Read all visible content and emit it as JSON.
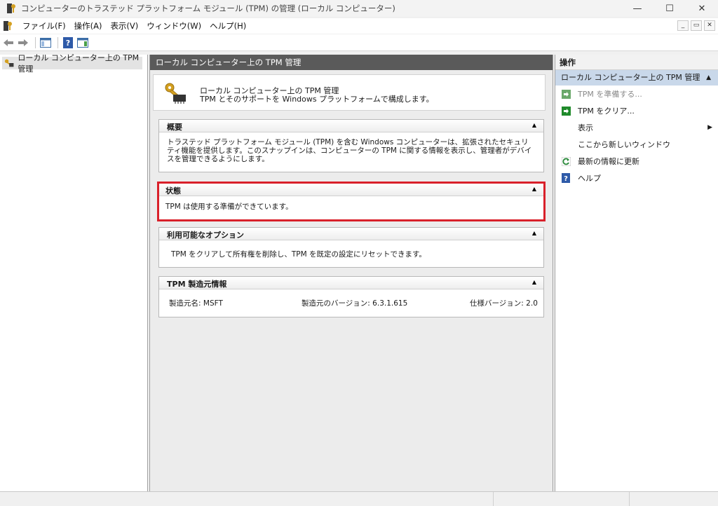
{
  "window": {
    "title": "コンピューターのトラステッド プラットフォーム モジュール (TPM) の管理 (ローカル コンピューター)",
    "minimize": "—",
    "maximize": "☐",
    "close": "✕"
  },
  "menu": {
    "items": [
      "ファイル(F)",
      "操作(A)",
      "表示(V)",
      "ウィンドウ(W)",
      "ヘルプ(H)"
    ],
    "mdi_min": "_",
    "mdi_restore": "▭",
    "mdi_close": "✕"
  },
  "tree": {
    "root_label": "ローカル コンピューター上の TPM 管理"
  },
  "center": {
    "header": "ローカル コンピューター上の TPM 管理",
    "intro_title": "ローカル コンピューター上の TPM 管理",
    "intro_subtitle": "TPM とそのサポートを Windows プラットフォームで構成します。",
    "overview": {
      "title": "概要",
      "text": "トラステッド プラットフォーム モジュール (TPM) を含む Windows コンピューターは、拡張されたセキュリティ機能を提供します。このスナップインは、コンピューターの TPM に関する情報を表示し、管理者がデバイスを管理できるようにします。"
    },
    "status": {
      "title": "状態",
      "text": "TPM は使用する準備ができています。"
    },
    "options": {
      "title": "利用可能なオプション",
      "text": "TPM をクリアして所有権を削除し、TPM を既定の設定にリセットできます。"
    },
    "manufacturer": {
      "title": "TPM 製造元情報",
      "name_label": "製造元名:",
      "name_value": "MSFT",
      "version_label": "製造元のバージョン:",
      "version_value": "6.3.1.615",
      "spec_label": "仕様バージョン:",
      "spec_value": "2.0"
    },
    "collapse_glyph": "▲"
  },
  "actions": {
    "header": "操作",
    "group_title": "ローカル コンピューター上の TPM 管理",
    "items": [
      {
        "label": "TPM を準備する...",
        "icon": "green-arrow-icon",
        "enabled": false
      },
      {
        "label": "TPM をクリア...",
        "icon": "green-arrow-icon",
        "enabled": true
      },
      {
        "label": "表示",
        "icon": "none",
        "enabled": true,
        "submenu": true
      },
      {
        "label": "ここから新しいウィンドウ",
        "icon": "none",
        "enabled": true
      },
      {
        "label": "最新の情報に更新",
        "icon": "refresh-icon",
        "enabled": true
      },
      {
        "label": "ヘルプ",
        "icon": "help-icon",
        "enabled": true
      }
    ],
    "submenu_glyph": "▶"
  },
  "colors": {
    "highlight_border": "#d9202a",
    "center_header_bg": "#5a5a5a",
    "action_group_bg": "#c9d8ea"
  }
}
